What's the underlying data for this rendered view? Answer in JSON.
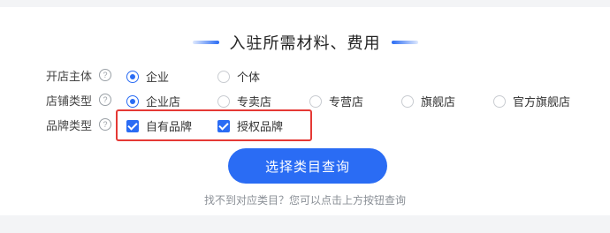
{
  "section_title": "入驻所需材料、费用",
  "rows": [
    {
      "label": "开店主体",
      "help": "?",
      "options": [
        {
          "label": "企业",
          "checked": true
        },
        {
          "label": "个体",
          "checked": false
        }
      ]
    },
    {
      "label": "店铺类型",
      "help": "?",
      "options": [
        {
          "label": "企业店",
          "checked": true
        },
        {
          "label": "专卖店",
          "checked": false
        },
        {
          "label": "专营店",
          "checked": false
        },
        {
          "label": "旗舰店",
          "checked": false
        },
        {
          "label": "官方旗舰店",
          "checked": false
        }
      ]
    },
    {
      "label": "品牌类型",
      "help": "?",
      "options": [
        {
          "label": "自有品牌",
          "checked": true
        },
        {
          "label": "授权品牌",
          "checked": true
        }
      ]
    }
  ],
  "button_label": "选择类目查询",
  "hint": "找不到对应类目？您可以点击上方按钮查询",
  "colors": {
    "accent": "#2a6cf4",
    "highlight": "#e53935"
  }
}
